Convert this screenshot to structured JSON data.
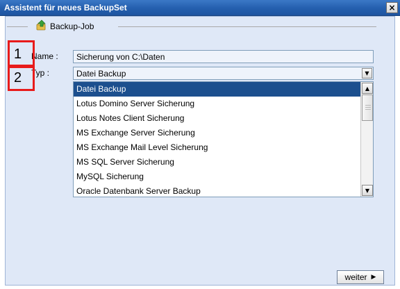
{
  "window": {
    "title": "Assistent für neues BackupSet",
    "close_icon": "×"
  },
  "backup_job": {
    "legend": "Backup-Job",
    "legend_icon": "backup-job-icon",
    "name_label": "Name :",
    "name_value": "Sicherung von C:\\Daten",
    "type_label": "Typ :",
    "type_value": "Datei Backup"
  },
  "dropdown": {
    "items": [
      "Datei Backup",
      "Lotus Domino Server Sicherung",
      "Lotus Notes Client Sicherung",
      "MS Exchange Server Sicherung",
      "MS Exchange Mail Level Sicherung",
      "MS SQL Server Sicherung",
      "MySQL Sicherung",
      "Oracle Datenbank Server Backup"
    ],
    "selected_index": 0,
    "scroll_up_glyph": "▲",
    "scroll_down_glyph": "▼"
  },
  "annotations": {
    "one": "1",
    "two": "2"
  },
  "footer": {
    "next_label": "weiter",
    "next_arrow": "▶"
  },
  "colors": {
    "titlebar": "#245fae",
    "selection": "#1c4f8e",
    "annotation_border": "#e81b1b",
    "client_bg": "#dfe8f7"
  }
}
